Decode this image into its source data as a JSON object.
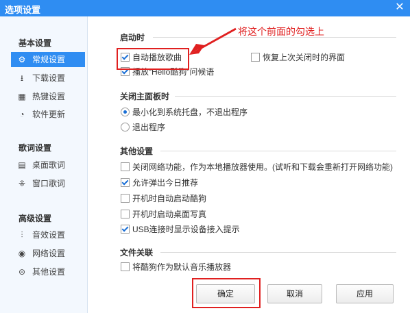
{
  "window": {
    "title": "选项设置",
    "close_glyph": "✕"
  },
  "sidebar": {
    "sections": [
      {
        "title": "基本设置",
        "items": [
          {
            "label": "常规设置",
            "icon": "gear-icon",
            "glyph": "⚙",
            "active": true
          },
          {
            "label": "下载设置",
            "icon": "download-icon",
            "glyph": "⭳",
            "active": false
          },
          {
            "label": "热键设置",
            "icon": "keyboard-icon",
            "glyph": "▦",
            "active": false
          },
          {
            "label": "软件更新",
            "icon": "update-icon",
            "glyph": "◔",
            "active": false
          }
        ]
      },
      {
        "title": "歌词设置",
        "items": [
          {
            "label": "桌面歌词",
            "icon": "desktop-lyrics-icon",
            "glyph": "▤",
            "active": false
          },
          {
            "label": "窗口歌词",
            "icon": "window-lyrics-icon",
            "glyph": "⁜",
            "active": false
          }
        ]
      },
      {
        "title": "高级设置",
        "items": [
          {
            "label": "音效设置",
            "icon": "equalizer-icon",
            "glyph": "⫶",
            "active": false
          },
          {
            "label": "网络设置",
            "icon": "network-icon",
            "glyph": "◉",
            "active": false
          },
          {
            "label": "其他设置",
            "icon": "more-icon",
            "glyph": "⊝",
            "active": false
          }
        ]
      }
    ]
  },
  "main": {
    "startup": {
      "title": "启动时",
      "autoplay": {
        "label": "自动播放歌曲",
        "checked": true
      },
      "restore": {
        "label": "恢复上次关闭时的界面",
        "checked": false
      },
      "greeting": {
        "label": "播放“Hello酷狗”问候语",
        "checked": true
      }
    },
    "close_panel": {
      "title": "关闭主面板时",
      "minimize": {
        "label": "最小化到系统托盘，不退出程序",
        "checked": true
      },
      "exit": {
        "label": "退出程序",
        "checked": false
      }
    },
    "other": {
      "title": "其他设置",
      "network_off": {
        "label": "关闭网络功能，作为本地播放器使用。(试听和下载会重新打开网络功能)",
        "checked": false
      },
      "daily_rec": {
        "label": "允许弹出今日推荐",
        "checked": true
      },
      "autostart": {
        "label": "开机时自动启动酷狗",
        "checked": false
      },
      "desktop_photo": {
        "label": "开机时启动桌面写真",
        "checked": false
      },
      "usb_prompt": {
        "label": "USB连接时显示设备接入提示",
        "checked": true
      }
    },
    "file_assoc": {
      "title": "文件关联",
      "default_player": {
        "label": "将酷狗作为默认音乐播放器",
        "checked": false
      }
    }
  },
  "annotation": {
    "text": "将这个前面的勾选上",
    "color": "#e02020"
  },
  "buttons": {
    "ok": "确定",
    "cancel": "取消",
    "apply": "应用"
  },
  "colors": {
    "accent": "#2f8df2",
    "annotation": "#e02020"
  }
}
